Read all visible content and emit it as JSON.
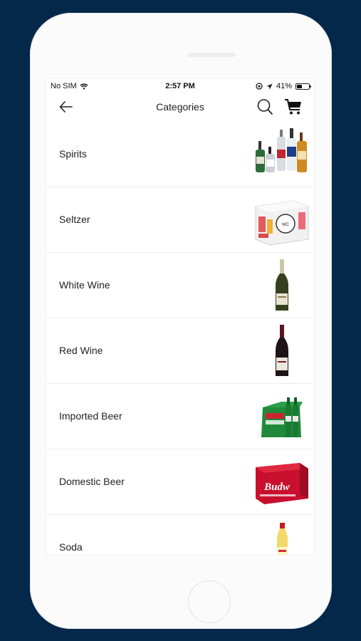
{
  "status_bar": {
    "carrier": "No SIM",
    "time": "2:57 PM",
    "battery": "41%",
    "battery_level": 0.41
  },
  "nav": {
    "title": "Categories",
    "back_icon": "arrow-left-icon",
    "search_icon": "search-icon",
    "cart_icon": "cart-icon"
  },
  "categories": [
    {
      "label": "Spirits",
      "image": "spirits-bottles-image"
    },
    {
      "label": "Seltzer",
      "image": "seltzer-cans-image"
    },
    {
      "label": "White Wine",
      "image": "white-wine-bottle-image"
    },
    {
      "label": "Red Wine",
      "image": "red-wine-bottle-image"
    },
    {
      "label": "Imported Beer",
      "image": "imported-beer-pack-image"
    },
    {
      "label": "Domestic Beer",
      "image": "domestic-beer-case-image"
    },
    {
      "label": "Soda",
      "image": "soda-bottle-image"
    }
  ],
  "colors": {
    "background": "#04284a",
    "phone": "#fbfbfc",
    "text": "#222222",
    "divider": "#ededed"
  }
}
